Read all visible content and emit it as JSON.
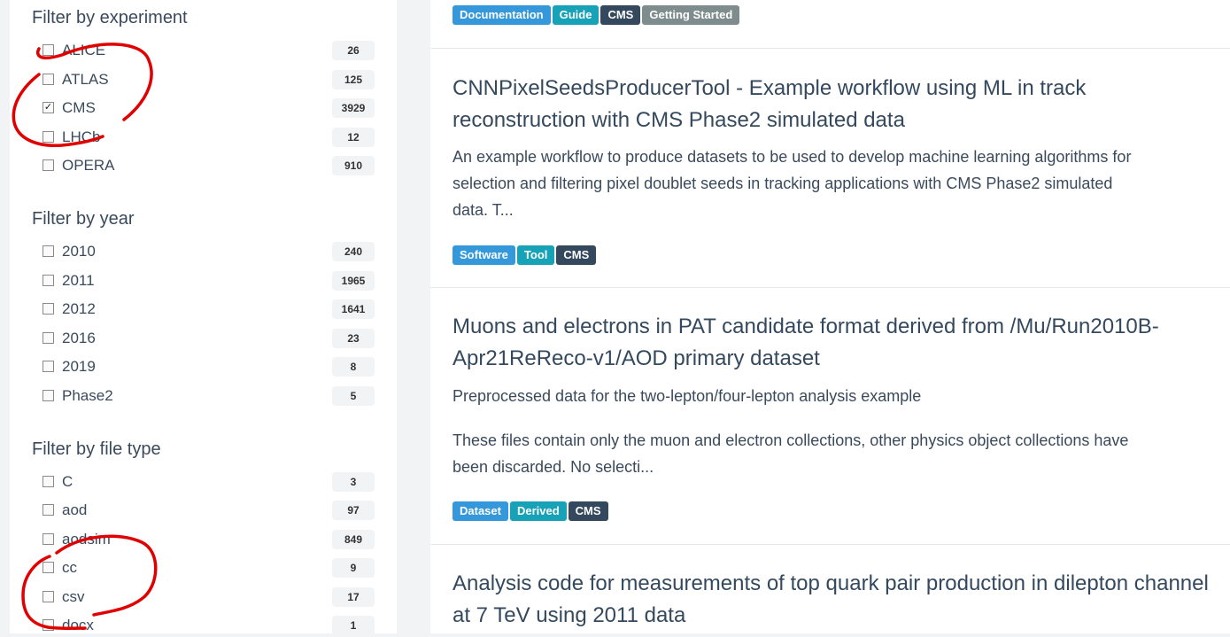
{
  "sidebar": {
    "experiment": {
      "title": "Filter by experiment",
      "items": [
        {
          "label": "ALICE",
          "count": "26",
          "checked": false
        },
        {
          "label": "ATLAS",
          "count": "125",
          "checked": false
        },
        {
          "label": "CMS",
          "count": "3929",
          "checked": true
        },
        {
          "label": "LHCb",
          "count": "12",
          "checked": false
        },
        {
          "label": "OPERA",
          "count": "910",
          "checked": false
        }
      ]
    },
    "year": {
      "title": "Filter by year",
      "items": [
        {
          "label": "2010",
          "count": "240",
          "checked": false
        },
        {
          "label": "2011",
          "count": "1965",
          "checked": false
        },
        {
          "label": "2012",
          "count": "1641",
          "checked": false
        },
        {
          "label": "2016",
          "count": "23",
          "checked": false
        },
        {
          "label": "2019",
          "count": "8",
          "checked": false
        },
        {
          "label": "Phase2",
          "count": "5",
          "checked": false
        }
      ]
    },
    "filetype": {
      "title": "Filter by file type",
      "items": [
        {
          "label": "C",
          "count": "3",
          "checked": false
        },
        {
          "label": "aod",
          "count": "97",
          "checked": false
        },
        {
          "label": "aodsim",
          "count": "849",
          "checked": false
        },
        {
          "label": "cc",
          "count": "9",
          "checked": false
        },
        {
          "label": "csv",
          "count": "17",
          "checked": false
        },
        {
          "label": "docx",
          "count": "1",
          "checked": false
        }
      ]
    }
  },
  "colors": {
    "badge_blue": "#3498db",
    "badge_teal": "#17a2b8",
    "badge_navy": "#34495e",
    "badge_gray": "#7f8c8d",
    "annotation_red": "#e00000"
  },
  "cards": [
    {
      "badges": [
        {
          "label": "Documentation",
          "color": "#3498db"
        },
        {
          "label": "Guide",
          "color": "#17a2b8"
        },
        {
          "label": "CMS",
          "color": "#34495e"
        },
        {
          "label": "Getting Started",
          "color": "#7f8c8d"
        }
      ]
    },
    {
      "title_line1": "CNNPixelSeedsProducerTool - Example workflow using ML in track",
      "title_line2": "reconstruction with CMS Phase2 simulated data",
      "desc_line1": "An example workflow to produce datasets to be used to develop machine learning algorithms for",
      "desc_line2": "selection and filtering pixel doublet seeds in tracking applications with CMS Phase2 simulated",
      "desc_line3": "data. T...",
      "badges": [
        {
          "label": "Software",
          "color": "#3498db"
        },
        {
          "label": "Tool",
          "color": "#17a2b8"
        },
        {
          "label": "CMS",
          "color": "#34495e"
        }
      ]
    },
    {
      "title_line1": "Muons and electrons in PAT candidate format derived from /Mu/Run2010B-",
      "title_line2": "Apr21ReReco-v1/AOD primary dataset",
      "desc_line1": "Preprocessed data for the two-lepton/four-lepton analysis example",
      "desc_line2": "These files contain only the muon and electron collections, other physics object collections have",
      "desc_line3": "been discarded. No selecti...",
      "badges": [
        {
          "label": "Dataset",
          "color": "#3498db"
        },
        {
          "label": "Derived",
          "color": "#17a2b8"
        },
        {
          "label": "CMS",
          "color": "#34495e"
        }
      ]
    },
    {
      "title_line1": "Analysis code for measurements of top quark pair production in dilepton channel",
      "title_line2": "at 7 TeV using 2011 data"
    }
  ]
}
